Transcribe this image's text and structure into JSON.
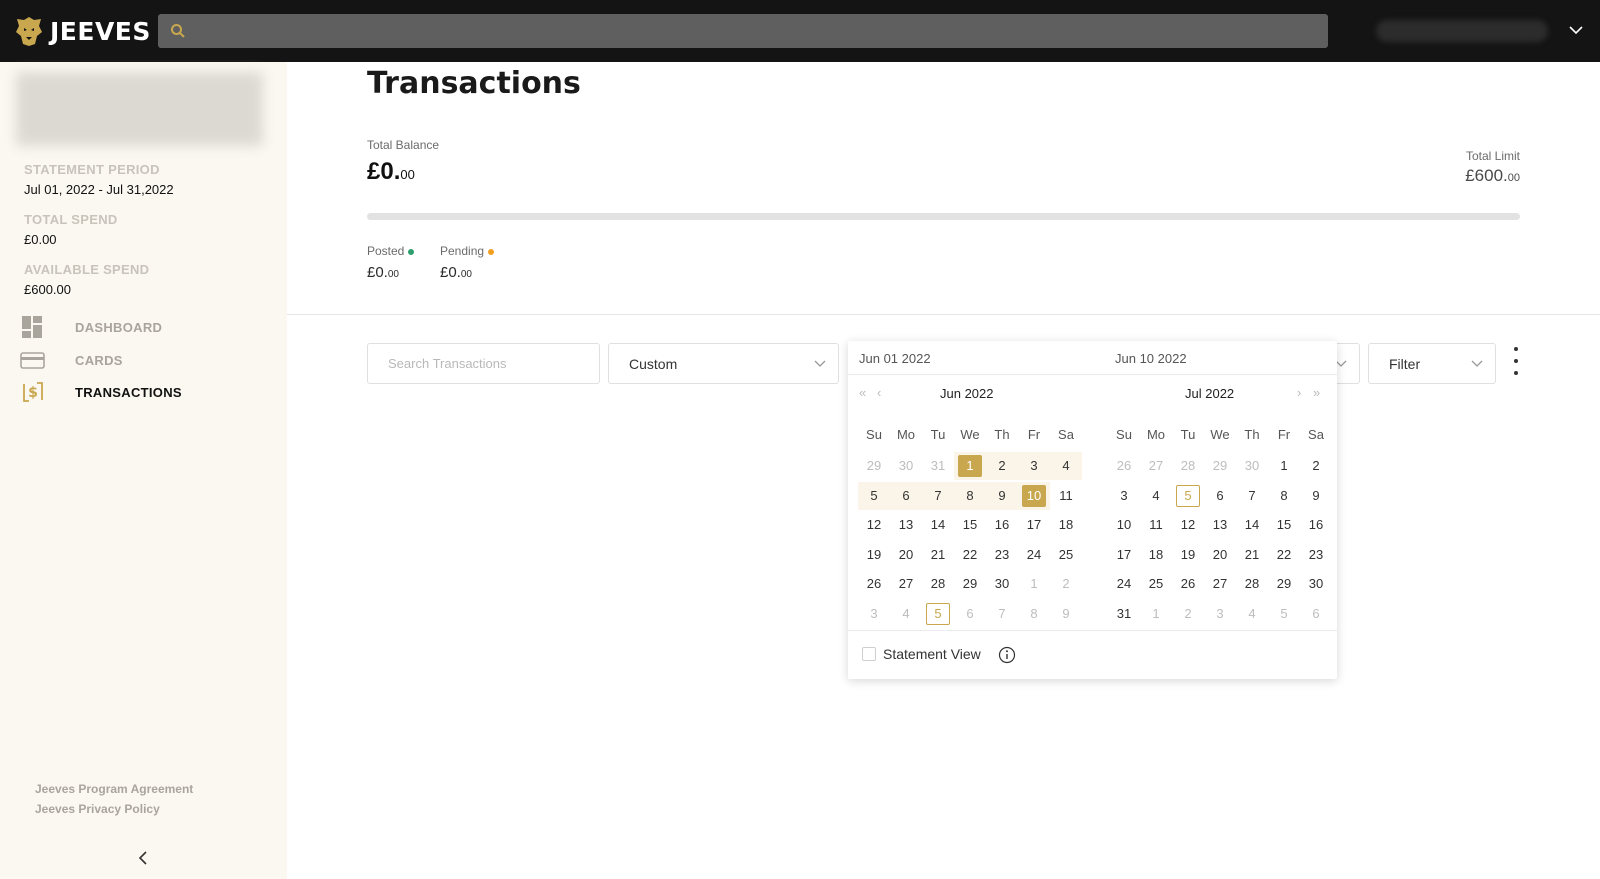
{
  "header": {
    "logo_text": "JEEVES",
    "logo_icon": "lion-head-icon",
    "search_placeholder": ""
  },
  "sidebar": {
    "stats": [
      {
        "label": "STATEMENT PERIOD",
        "value": "Jul 01, 2022 - Jul 31,2022"
      },
      {
        "label": "TOTAL SPEND",
        "value": "£0.00"
      },
      {
        "label": "AVAILABLE SPEND",
        "value": "£600.00"
      }
    ],
    "nav": [
      {
        "label": "DASHBOARD",
        "icon": "dashboard-icon",
        "active": false
      },
      {
        "label": "CARDS",
        "icon": "card-icon",
        "active": false
      },
      {
        "label": "TRANSACTIONS",
        "icon": "transactions-icon",
        "active": true
      }
    ],
    "footer_links": [
      "Jeeves Program Agreement",
      "Jeeves Privacy Policy"
    ]
  },
  "main": {
    "title": "Transactions",
    "total_balance_label": "Total Balance",
    "total_balance_main": "£0.",
    "total_balance_cents": "00",
    "total_limit_label": "Total Limit",
    "total_limit_main": "£600.",
    "total_limit_cents": "00",
    "balance_used_fraction": 0,
    "posted_label": "Posted",
    "posted_main": "£0.",
    "posted_cents": "00",
    "pending_label": "Pending",
    "pending_main": "£0.",
    "pending_cents": "00",
    "colors": {
      "accent": "#c9a74f",
      "posted_dot": "#2e9e6e",
      "pending_dot": "#f0a020"
    }
  },
  "toolbar": {
    "search_placeholder": "Search Transactions",
    "period_select": "Custom",
    "filter_select": "Filter"
  },
  "date_picker": {
    "start_input": "Jun 01 2022",
    "end_input": "Jun 10 2022",
    "left_month": "Jun 2022",
    "right_month": "Jul 2022",
    "weekdays": [
      "Su",
      "Mo",
      "Tu",
      "We",
      "Th",
      "Fr",
      "Sa"
    ],
    "left_weeks": [
      [
        "29",
        "30",
        "31",
        "1",
        "2",
        "3",
        "4"
      ],
      [
        "5",
        "6",
        "7",
        "8",
        "9",
        "10",
        "11"
      ],
      [
        "12",
        "13",
        "14",
        "15",
        "16",
        "17",
        "18"
      ],
      [
        "19",
        "20",
        "21",
        "22",
        "23",
        "24",
        "25"
      ],
      [
        "26",
        "27",
        "28",
        "29",
        "30",
        "1",
        "2"
      ],
      [
        "3",
        "4",
        "5",
        "6",
        "7",
        "8",
        "9"
      ]
    ],
    "right_weeks": [
      [
        "26",
        "27",
        "28",
        "29",
        "30",
        "1",
        "2"
      ],
      [
        "3",
        "4",
        "5",
        "6",
        "7",
        "8",
        "9"
      ],
      [
        "10",
        "11",
        "12",
        "13",
        "14",
        "15",
        "16"
      ],
      [
        "17",
        "18",
        "19",
        "20",
        "21",
        "22",
        "23"
      ],
      [
        "24",
        "25",
        "26",
        "27",
        "28",
        "29",
        "30"
      ],
      [
        "31",
        "1",
        "2",
        "3",
        "4",
        "5",
        "6"
      ]
    ],
    "statement_view_label": "Statement View",
    "statement_view_checked": false
  }
}
